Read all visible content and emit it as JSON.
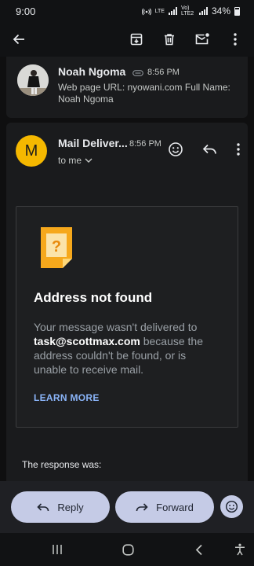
{
  "status": {
    "time": "9:00",
    "lte1": "LTE",
    "lte2": "Vo) LTE2",
    "battery": "34%"
  },
  "toolbar": {
    "icons": [
      "back-arrow-icon",
      "archive-icon",
      "delete-icon",
      "mark-unread-icon",
      "more-vert-icon"
    ]
  },
  "previous_message": {
    "sender": "Noah Ngoma",
    "time": "8:56 PM",
    "snippet": "Web page URL: nyowani.com Full Name: Noah Ngoma"
  },
  "message": {
    "avatar_letter": "M",
    "avatar_color": "#f5b800",
    "sender": "Mail Deliver...",
    "time": "8:56 PM",
    "to": "to me",
    "bounce": {
      "title": "Address not found",
      "body_before": "Your message wasn't delivered to",
      "address": "task@scottmax.com",
      "body_after": "because the address couldn't be found, or is unable to receive mail.",
      "link": "LEARN MORE"
    },
    "response_label": "The response was:"
  },
  "actions": {
    "reply": "Reply",
    "forward": "Forward"
  },
  "colors": {
    "link": "#8ab4f8",
    "pill": "#c5cbe6",
    "sticky_note": "#f6a81c"
  }
}
